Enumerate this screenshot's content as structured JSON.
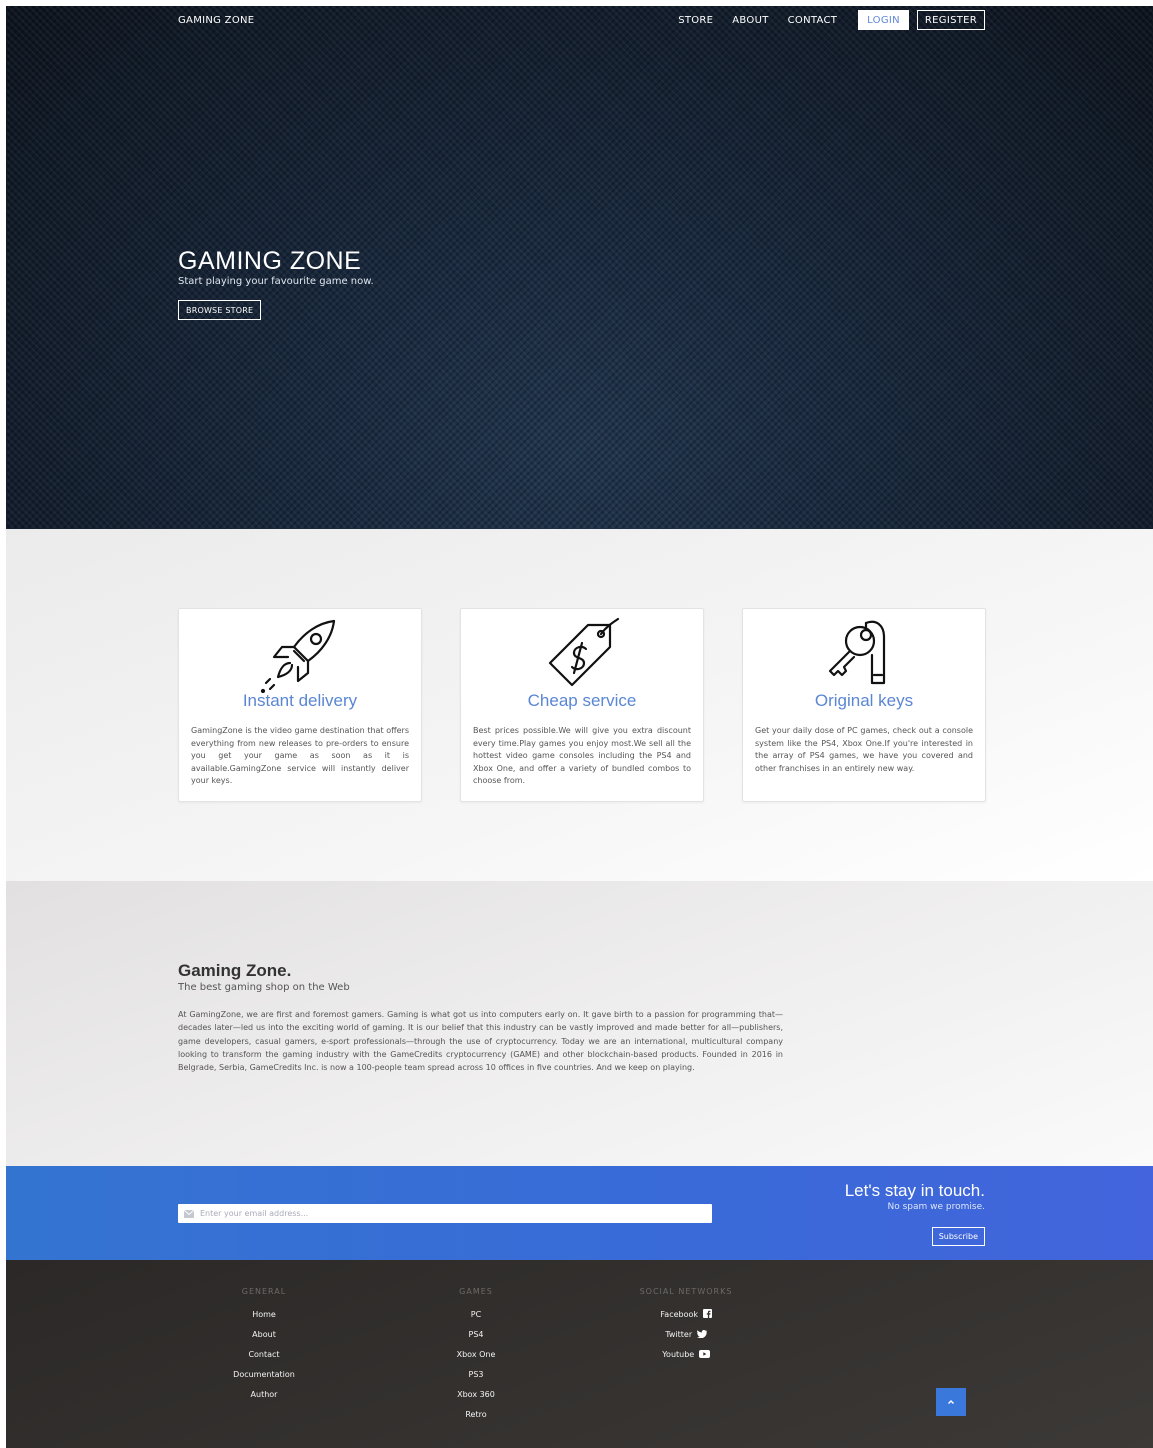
{
  "nav": {
    "brand": "GAMING ZONE",
    "links": [
      "STORE",
      "ABOUT",
      "CONTACT"
    ],
    "login": "LOGIN",
    "register": "REGISTER"
  },
  "hero": {
    "title": "GAMING ZONE",
    "subtitle": "Start playing your favourite game now.",
    "button": "BROWSE STORE"
  },
  "features": [
    {
      "icon": "rocket-icon",
      "title": "Instant delivery",
      "text": "GamingZone is the video game destination that offers everything from new releases to pre-orders to ensure you get your game as soon as it is available.GamingZone service will instantly deliver your keys."
    },
    {
      "icon": "price-tag-icon",
      "title": "Cheap service",
      "text": "Best prices possible.We will give you extra discount every time.Play games you enjoy most.We sell all the hottest video game consoles including the PS4 and Xbox One, and offer a variety of bundled combos to choose from."
    },
    {
      "icon": "keys-icon",
      "title": "Original keys",
      "text": "Get your daily dose of PC games, check out a console system like the PS4, Xbox One.If you're interested in the array of PS4 games, we have you covered and other franchises in an entirely new way."
    }
  ],
  "about": {
    "title": "Gaming Zone.",
    "subtitle": "The best gaming shop on the Web",
    "text": "At GamingZone, we are first and foremost gamers. Gaming is what got us into computers early on. It gave birth to a passion for programming that—decades later—led us into the exciting world of gaming. It is our belief that this industry can be vastly improved and made better for all—publishers, game developers, casual gamers, e-sport professionals—through the use of cryptocurrency. Today we are an international, multicultural company looking to transform the gaming industry with the GameCredits cryptocurrency (GAME) and other blockchain-based products. Founded in 2016 in Belgrade, Serbia, GameCredits Inc. is now a 100-people team spread across 10 offices in five countries. And we keep on playing."
  },
  "newsletter": {
    "placeholder": "Enter your email address...",
    "title": "Let's stay in touch.",
    "subtitle": "No spam we promise.",
    "button": "Subscribe"
  },
  "footer": {
    "general": {
      "heading": "GENERAL",
      "items": [
        "Home",
        "About",
        "Contact",
        "Documentation",
        "Author"
      ]
    },
    "games": {
      "heading": "GAMES",
      "items": [
        "PC",
        "PS4",
        "Xbox One",
        "PS3",
        "Xbox 360",
        "Retro"
      ]
    },
    "social": {
      "heading": "SOCIAL NETWORKS",
      "items": [
        "Facebook",
        "Twitter",
        "Youtube"
      ]
    }
  },
  "colors": {
    "accent_blue": "#5a86d4",
    "newsletter_blue": "#3a6fd6",
    "footer_dark": "#322f2d",
    "hero_dark": "#15202d"
  }
}
